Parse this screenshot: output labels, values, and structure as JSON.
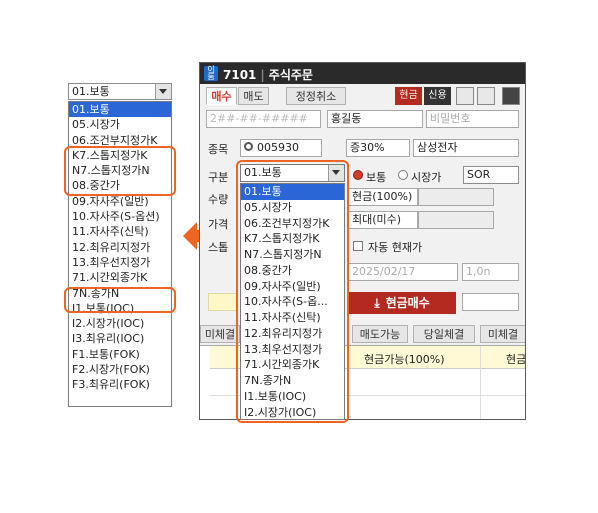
{
  "left_dropdown": {
    "selected": "01.보통",
    "items": [
      "01.보통",
      "05.시장가",
      "06.조건부지정가K",
      "K7.스톱지정가K",
      "N7.스톱지정가N",
      "08.중간가",
      "09.자사주(일반)",
      "10.자사주(S-옵션)",
      "11.자사주(신탁)",
      "12.최유리지정가",
      "13.최우선지정가",
      "71.시간외종가K",
      "7N.종가N",
      "I1.보통(IOC)",
      "I2.시장가(IOC)",
      "I3.최유리(IOC)",
      "F1.보통(FOK)",
      "F2.시장가(FOK)",
      "F3.최유리(FOK)"
    ]
  },
  "window": {
    "logo": "이룸",
    "screen_no": "7101",
    "title": "주식주문",
    "tabs": [
      "매수",
      "매도",
      "정정취소"
    ],
    "buttons": {
      "cash": "현금",
      "credit": "신용"
    },
    "account": "2##-##-#####",
    "account_name": "홍길동",
    "password_placeholder": "비밀번호",
    "stock_label": "종목",
    "stock_code": "005930",
    "margin": "증30%",
    "stock_name": "삼성전자",
    "type_label": "구분",
    "order_type": "01.보통",
    "radio_normal": "보통",
    "radio_market": "시장가",
    "sor": "SOR",
    "qty_label": "수량",
    "price_label": "가격",
    "stop_label": "스톱",
    "cash100": "현금(100%)",
    "max_misu": "최대(미수)",
    "auto_price": "자동 현재가",
    "date": "2025/02/17",
    "valid": "1,0n",
    "buy_button": "현금매수",
    "bottom_tabs": [
      "미체결",
      "매도가능",
      "당일체결",
      "미체결"
    ],
    "grid_header": "현금가능(100%)",
    "grid_header2": "현금"
  },
  "open_dropdown": {
    "selected": "01.보통",
    "items": [
      "01.보통",
      "05.시장가",
      "06.조건부지정가K",
      "K7.스톱지정가K",
      "N7.스톱지정가N",
      "08.중간가",
      "09.자사주(일반)",
      "10.자사주(S-옵...",
      "11.자사주(신탁)",
      "12.최유리지정가",
      "13.최우선지정가",
      "71.시간외종가K",
      "7N.종가N",
      "I1.보통(IOC)",
      "I2.시장가(IOC)"
    ]
  },
  "colors": {
    "highlight": "#f06423",
    "accent": "#d23c2c",
    "selected": "#2a66d6"
  }
}
